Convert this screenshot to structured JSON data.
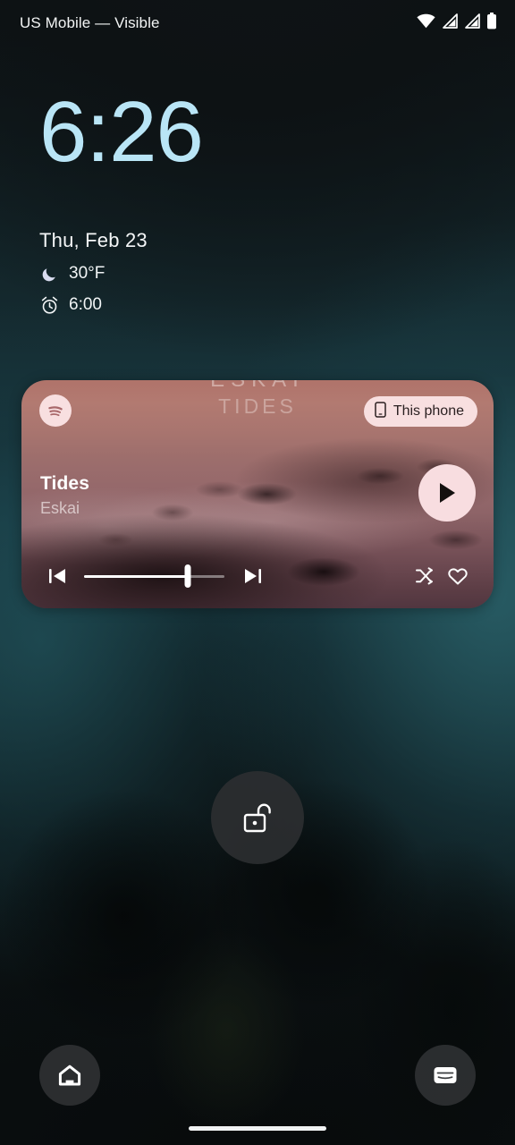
{
  "status_bar": {
    "carrier": "US Mobile — Visible",
    "icons": [
      {
        "name": "wifi-icon",
        "label": "Wi-Fi"
      },
      {
        "name": "cellular-signal-icon-1",
        "label": "Cellular signal SIM 1"
      },
      {
        "name": "cellular-signal-icon-2",
        "label": "Cellular signal SIM 2"
      },
      {
        "name": "battery-icon",
        "label": "Battery"
      }
    ]
  },
  "lock_screen": {
    "clock": "6:26",
    "date": "Thu, Feb 23",
    "weather": {
      "icon": "moon-icon",
      "temperature": "30°F"
    },
    "alarm": {
      "icon": "alarm-clock-icon",
      "time": "6:00"
    },
    "unlock_label": "Unlock",
    "unlock_icon": "unlock-padlock-icon"
  },
  "media_player": {
    "app_icon": "spotify-icon",
    "device_chip": {
      "icon": "phone-icon",
      "label": "This phone"
    },
    "album_art": {
      "title_top": "ESKAI",
      "title_sub": "TIDES"
    },
    "track_title": "Tides",
    "track_artist": "Eskai",
    "play_button": {
      "icon": "play-icon",
      "label": "Play"
    },
    "progress_percent": 74,
    "controls": [
      {
        "name": "previous-track-button",
        "icon": "skip-previous-icon",
        "label": "Previous"
      },
      {
        "name": "next-track-button",
        "icon": "skip-next-icon",
        "label": "Next"
      },
      {
        "name": "shuffle-button",
        "icon": "shuffle-icon",
        "label": "Shuffle"
      },
      {
        "name": "favorite-button",
        "icon": "heart-outline-icon",
        "label": "Favorite"
      }
    ]
  },
  "shortcuts": {
    "left": {
      "name": "home-shortcut",
      "icon": "home-icon",
      "label": "Home"
    },
    "right": {
      "name": "wallet-shortcut",
      "icon": "wallet-icon",
      "label": "Wallet"
    }
  },
  "navigation": {
    "home_indicator": "Home gesture bar"
  },
  "colors": {
    "clock": "#b9e5f6",
    "accent_pink": "#f8dfe0",
    "card_bg": "#9d6e6c",
    "wallpaper_teal": "#1d4650"
  }
}
